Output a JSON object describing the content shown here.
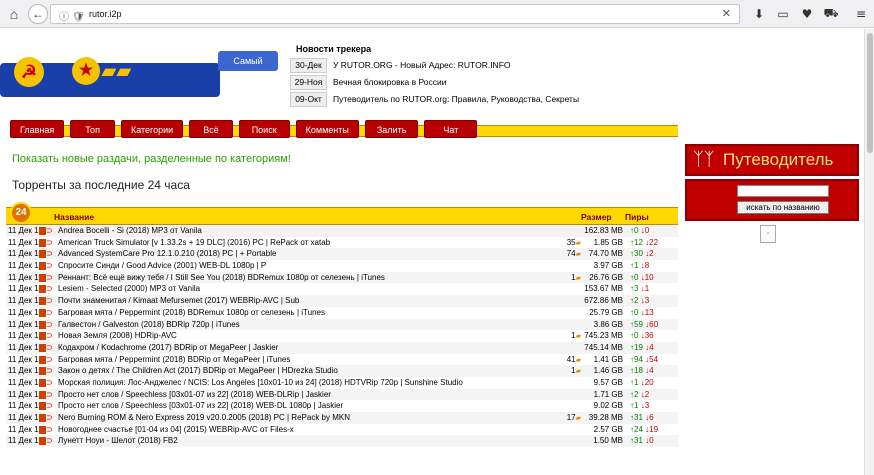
{
  "browser": {
    "url": "rutor.i2p",
    "icons": [
      "home-icon",
      "back-icon",
      "info-icon",
      "shield-icon",
      "close-icon",
      "download-icon",
      "library-icon",
      "pocket-icon",
      "cart-icon",
      "menu-icon"
    ]
  },
  "logo": {
    "tag": "Самый"
  },
  "news": {
    "title": "Новости трекера",
    "items": [
      {
        "date": "30-Дек",
        "text": "У RUTOR.ORG - Новый Адрес: RUTOR.INFO"
      },
      {
        "date": "29-Ноя",
        "text": "Вечная блокировка в России"
      },
      {
        "date": "09-Окт",
        "text": "Путеводитель по RUTOR.org: Правила, Руководства, Секреты"
      }
    ]
  },
  "menu": [
    "Главная",
    "Топ",
    "Категории",
    "Всё",
    "Поиск",
    "Комменты",
    "Залить",
    "Чат"
  ],
  "show_new": "Показать новые раздачи, разделенные по категориям!",
  "heading": "Торренты за последние 24 часа",
  "sidebar": {
    "guide": "Путеводитель",
    "search_button": "искать по названию"
  },
  "table": {
    "badge": "24",
    "headers": {
      "name": "Название",
      "size": "Размер",
      "peers": "Пиры"
    },
    "rows": [
      {
        "date": "11 Дек 18",
        "title": "Andrea Bocelli - Si (2018) MP3 от Vanila",
        "comments": "",
        "size": "162.83 MB",
        "seeds": "0",
        "leech": "0"
      },
      {
        "date": "11 Дек 18",
        "title": "American Truck Simulator [v 1.33.2s + 19 DLC] (2016) PC | RePack от xatab",
        "comments": "35",
        "size": "1.85 GB",
        "seeds": "12",
        "leech": "22"
      },
      {
        "date": "11 Дек 18",
        "title": "Advanced SystemCare Pro 12.1.0.210 (2018) PC | + Portable",
        "comments": "74",
        "size": "74.70 MB",
        "seeds": "30",
        "leech": "2"
      },
      {
        "date": "11 Дек 18",
        "title": "Спросите Синди / Good Advice (2001) WEB-DL 1080p | P",
        "comments": "",
        "size": "3.97 GB",
        "seeds": "1",
        "leech": "8"
      },
      {
        "date": "11 Дек 18",
        "title": "Реннант: Всё ещё вижу тебя / I Still See You (2018) BDRemux 1080p от селезень | iTunes",
        "comments": "1",
        "size": "26.76 GB",
        "seeds": "0",
        "leech": "10"
      },
      {
        "date": "11 Дек 18",
        "title": "Lesiem - Selected (2000) MP3 от Vanila",
        "comments": "",
        "size": "153.67 MB",
        "seeds": "3",
        "leech": "1"
      },
      {
        "date": "11 Дек 18",
        "title": "Почти знаменитая / Kimaat Mefursemet (2017) WEBRip-AVC | Sub",
        "comments": "",
        "size": "672.86 MB",
        "seeds": "2",
        "leech": "3"
      },
      {
        "date": "11 Дек 18",
        "title": "Багровая мята / Peppermint (2018) BDRemux 1080p от селезень | iTunes",
        "comments": "",
        "size": "25.79 GB",
        "seeds": "0",
        "leech": "13"
      },
      {
        "date": "11 Дек 18",
        "title": "Галвестон / Galveston (2018) BDRip 720p | iTunes",
        "comments": "",
        "size": "3.86 GB",
        "seeds": "59",
        "leech": "60"
      },
      {
        "date": "11 Дек 18",
        "title": "Новая Земля (2008) HDRip-AVC",
        "comments": "1",
        "size": "745.23 MB",
        "seeds": "0",
        "leech": "36"
      },
      {
        "date": "11 Дек 18",
        "title": "Кодахром / Kodachrome (2017) BDRip от MegaPeer | Jaskier",
        "comments": "",
        "size": "745.14 MB",
        "seeds": "19",
        "leech": "4"
      },
      {
        "date": "11 Дек 18",
        "title": "Багровая мята / Peppermint (2018) BDRip от MegaPeer | iTunes",
        "comments": "41",
        "size": "1.41 GB",
        "seeds": "94",
        "leech": "54"
      },
      {
        "date": "11 Дек 18",
        "title": "Закон о детях / The Children Act (2017) BDRip от MegaPeer | HDrezka Studio",
        "comments": "1",
        "size": "1.46 GB",
        "seeds": "18",
        "leech": "4"
      },
      {
        "date": "11 Дек 18",
        "title": "Морская полиция: Лос-Анджелес / NCIS: Los Angeles [10x01-10 из 24] (2018) HDTVRip 720p | Sunshine Studio",
        "comments": "",
        "size": "9.57 GB",
        "seeds": "1",
        "leech": "20"
      },
      {
        "date": "11 Дек 18",
        "title": "Просто нет слов / Speechless [03x01-07 из 22] (2018) WEB-DLRip | Jaskier",
        "comments": "",
        "size": "1.71 GB",
        "seeds": "2",
        "leech": "2"
      },
      {
        "date": "11 Дек 18",
        "title": "Просто нет слов / Speechless [03x01-07 из 22] (2018) WEB-DL 1080p | Jaskier",
        "comments": "",
        "size": "9.02 GB",
        "seeds": "1",
        "leech": "3"
      },
      {
        "date": "11 Дек 18",
        "title": "Nero Burning ROM & Nero Express 2019 v20.0.2005 (2018) PC | RePack by MKN",
        "comments": "17",
        "size": "39.28 MB",
        "seeds": "31",
        "leech": "6"
      },
      {
        "date": "11 Дек 18",
        "title": "Новогоднее счастье [01-04 из 04] (2015) WEBRip-AVC от Files-x",
        "comments": "",
        "size": "2.57 GB",
        "seeds": "24",
        "leech": "19"
      },
      {
        "date": "11 Дек 18",
        "title": "Лунетт Ноуи - Шелот (2018) FB2",
        "comments": "",
        "size": "1.50 MB",
        "seeds": "31",
        "leech": "0"
      }
    ]
  }
}
